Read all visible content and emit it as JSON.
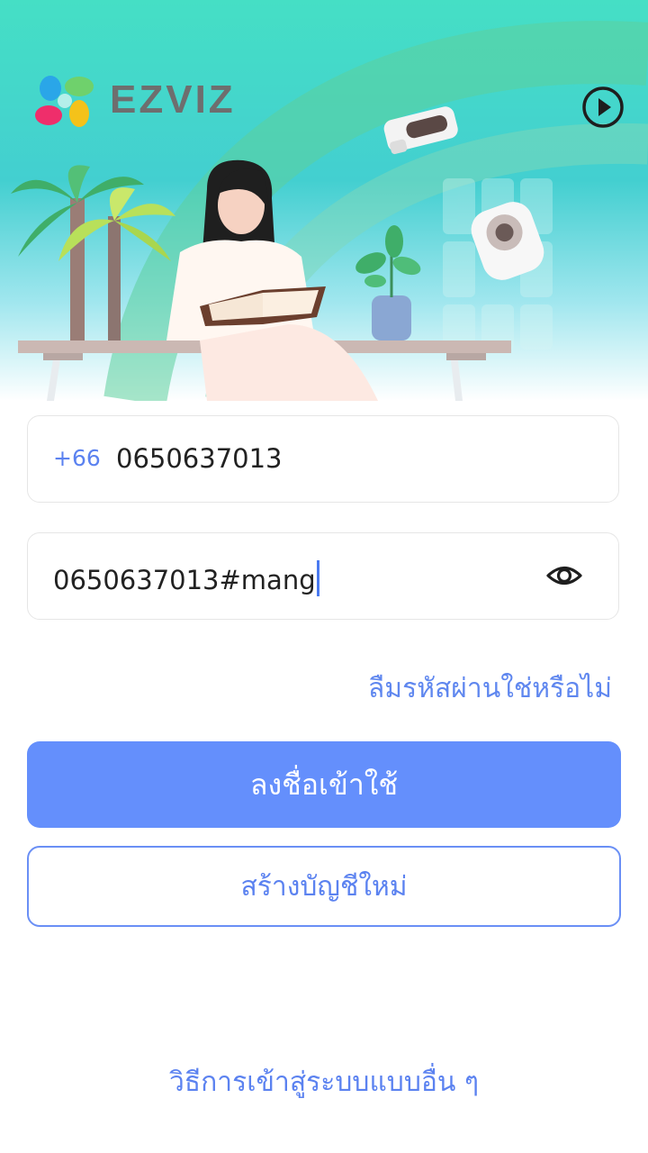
{
  "brand": {
    "name": "EZVIZ"
  },
  "header": {
    "play_icon": "play-circle-icon"
  },
  "login_form": {
    "phone": {
      "country_code": "+66",
      "value": "0650637013"
    },
    "password": {
      "value": "0650637013#mang",
      "toggle_icon": "eye-icon"
    },
    "forgot_password_label": "ลืมรหัสผ่านใช่หรือไม่",
    "login_button_label": "ลงชื่อเข้าใช้",
    "register_button_label": "สร้างบัญชีใหม่",
    "other_login_label": "วิธีการเข้าสู่ระบบแบบอื่น ๆ"
  },
  "colors": {
    "accent": "#648ffc",
    "link": "#5b82f0",
    "brand_text": "#6e6e6e"
  }
}
